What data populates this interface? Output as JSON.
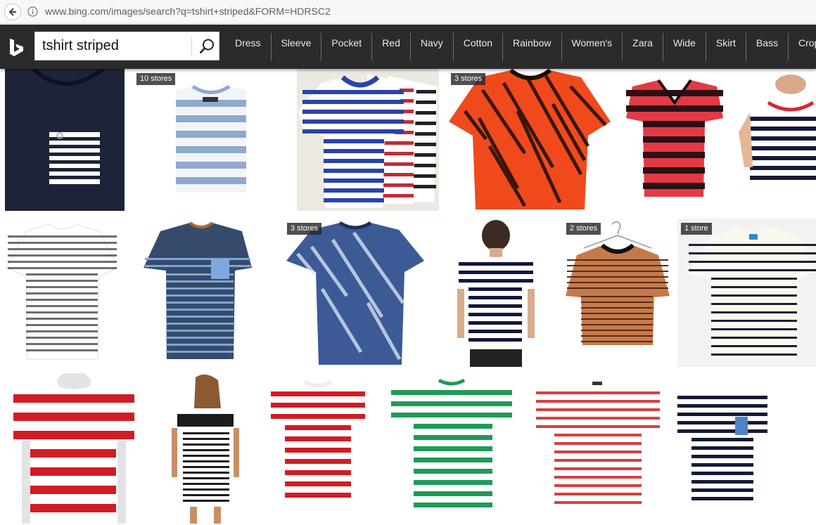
{
  "browser": {
    "url": "www.bing.com/images/search?q=tshirt+striped&FORM=HDRSC2"
  },
  "header": {
    "logo_icon": "bing-logo-icon",
    "search_query": "tshirt striped",
    "search_icon": "magnifier-icon",
    "background_color": "#2b2b2b"
  },
  "refinements": [
    "Dress",
    "Sleeve",
    "Pocket",
    "Red",
    "Navy",
    "Cotton",
    "Rainbow",
    "Women's",
    "Zara",
    "Wide",
    "Skirt",
    "Bass",
    "Cropp"
  ],
  "results": [
    {
      "badge": ""
    },
    {
      "badge": "10 stores"
    },
    {
      "badge": ""
    },
    {
      "badge": "3 stores"
    },
    {
      "badge": ""
    },
    {
      "badge": ""
    },
    {
      "badge": ""
    },
    {
      "badge": ""
    },
    {
      "badge": "3 stores"
    },
    {
      "badge": ""
    },
    {
      "badge": "2 stores"
    },
    {
      "badge": "1 store"
    },
    {
      "badge": ""
    },
    {
      "badge": ""
    },
    {
      "badge": ""
    },
    {
      "badge": ""
    },
    {
      "badge": ""
    },
    {
      "badge": ""
    }
  ],
  "colors": {
    "header": "#2b2b2b",
    "badge": "#282828",
    "red_stripe": "#cc1f24",
    "navy_stripe": "#1a1f3a",
    "green_stripe": "#1f9a56"
  }
}
